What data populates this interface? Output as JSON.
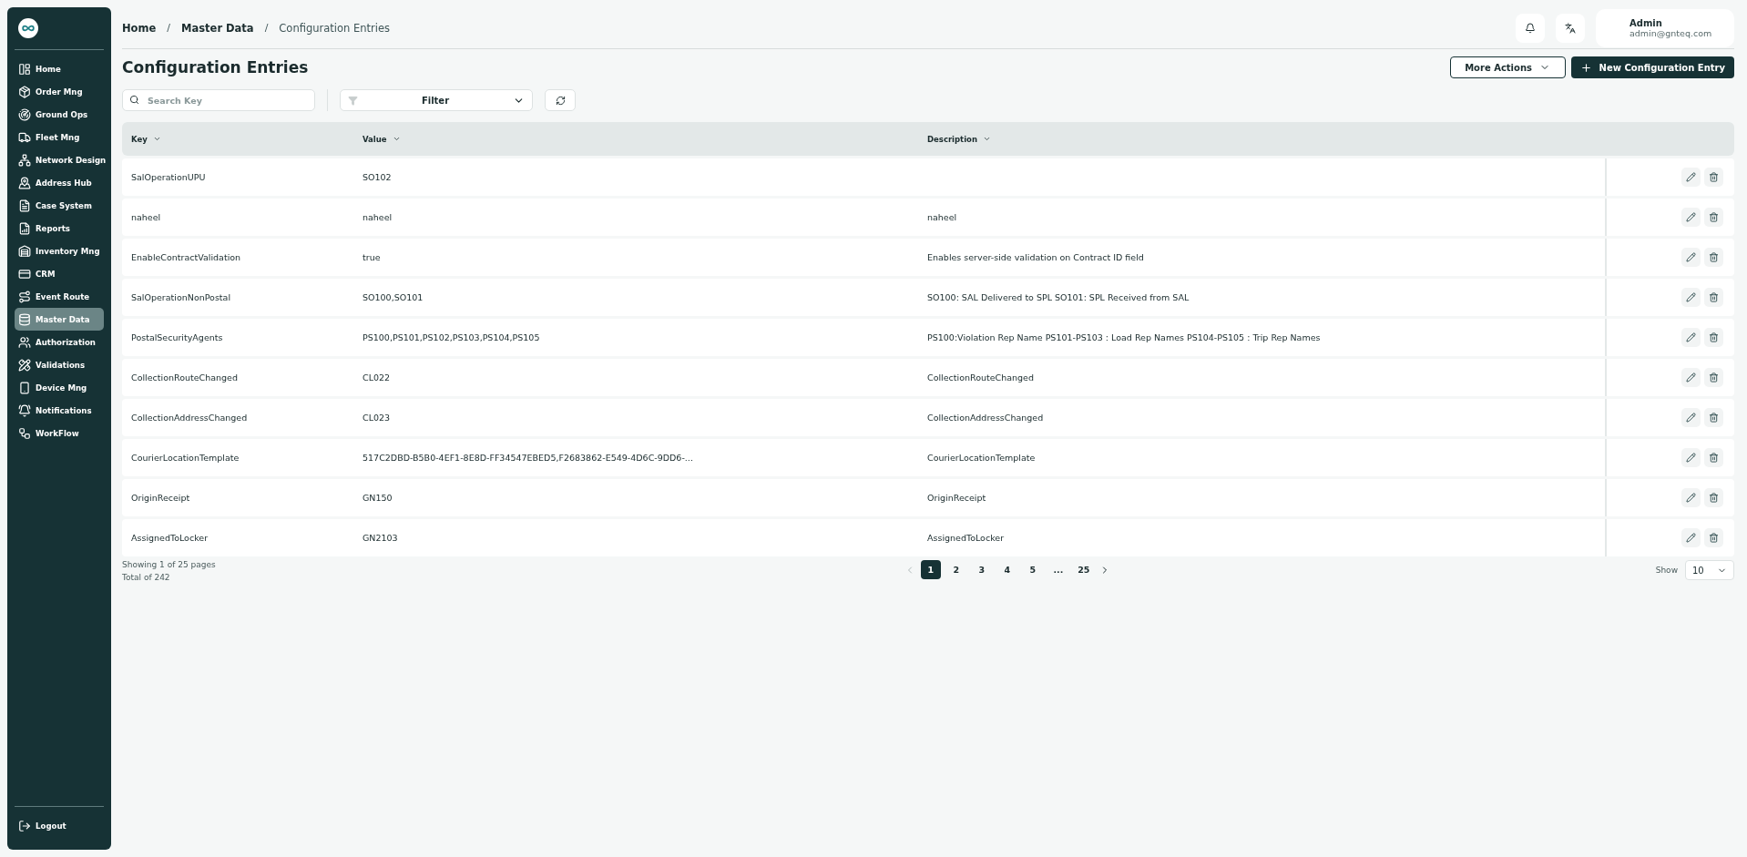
{
  "sidebar": {
    "items": [
      {
        "label": "Home",
        "selected": false
      },
      {
        "label": "Order Mng",
        "selected": false
      },
      {
        "label": "Ground Ops",
        "selected": false
      },
      {
        "label": "Fleet Mng",
        "selected": false
      },
      {
        "label": "Network Design",
        "selected": false
      },
      {
        "label": "Address Hub",
        "selected": false
      },
      {
        "label": "Case System",
        "selected": false
      },
      {
        "label": "Reports",
        "selected": false
      },
      {
        "label": "Inventory Mng",
        "selected": false
      },
      {
        "label": "CRM",
        "selected": false
      },
      {
        "label": "Event Route",
        "selected": false
      },
      {
        "label": "Master Data",
        "selected": true
      },
      {
        "label": "Authorization",
        "selected": false
      },
      {
        "label": "Validations",
        "selected": false
      },
      {
        "label": "Device Mng",
        "selected": false
      },
      {
        "label": "Notifications",
        "selected": false
      },
      {
        "label": "WorkFlow",
        "selected": false
      }
    ],
    "logout": "Logout"
  },
  "breadcrumb": {
    "separator": "/",
    "items": [
      "Home",
      "Master Data",
      "Configuration Entries"
    ]
  },
  "user": {
    "name": "Admin",
    "email": "admin@gnteq.com"
  },
  "page_title": "Configuration Entries",
  "actions": {
    "more": "More Actions",
    "new": "New Configuration Entry"
  },
  "search": {
    "placeholder": "Search Key"
  },
  "filter": {
    "label": "Filter"
  },
  "table": {
    "columns": [
      "Key",
      "Value",
      "Description"
    ],
    "rows": [
      {
        "key": "SalOperationUPU",
        "value": "SO102",
        "description": ""
      },
      {
        "key": "naheel",
        "value": "naheel",
        "description": "naheel"
      },
      {
        "key": "EnableContractValidation",
        "value": "true",
        "description": "Enables server-side validation on Contract ID field"
      },
      {
        "key": "SalOperationNonPostal",
        "value": "SO100,SO101",
        "description": "SO100: SAL Delivered to SPL SO101: SPL Received from SAL"
      },
      {
        "key": "PostalSecurityAgents",
        "value": "PS100,PS101,PS102,PS103,PS104,PS105",
        "description": "PS100:Violation Rep Name PS101-PS103 : Load Rep Names PS104-PS105 : Trip Rep Names"
      },
      {
        "key": "CollectionRouteChanged",
        "value": "CL022",
        "description": "CollectionRouteChanged"
      },
      {
        "key": "CollectionAddressChanged",
        "value": "CL023",
        "description": "CollectionAddressChanged"
      },
      {
        "key": "CourierLocationTemplate",
        "value": "517C2DBD-B5B0-4EF1-8E8D-FF34547EBED5,F2683862-E549-4D6C-9DD6-...",
        "description": "CourierLocationTemplate"
      },
      {
        "key": "OriginReceipt",
        "value": "GN150",
        "description": "OriginReceipt"
      },
      {
        "key": "AssignedToLocker",
        "value": "GN2103",
        "description": "AssignedToLocker"
      }
    ]
  },
  "pagination": {
    "summary": "Showing 1 of 25 pages",
    "total": "Total of 242",
    "pages": [
      {
        "label": "1",
        "selected": true
      },
      {
        "label": "2",
        "selected": false
      },
      {
        "label": "3",
        "selected": false
      },
      {
        "label": "4",
        "selected": false
      },
      {
        "label": "5",
        "selected": false
      },
      {
        "label": "...",
        "selected": false
      },
      {
        "label": "25",
        "selected": false
      }
    ],
    "show_label": "Show",
    "page_size": "10"
  }
}
